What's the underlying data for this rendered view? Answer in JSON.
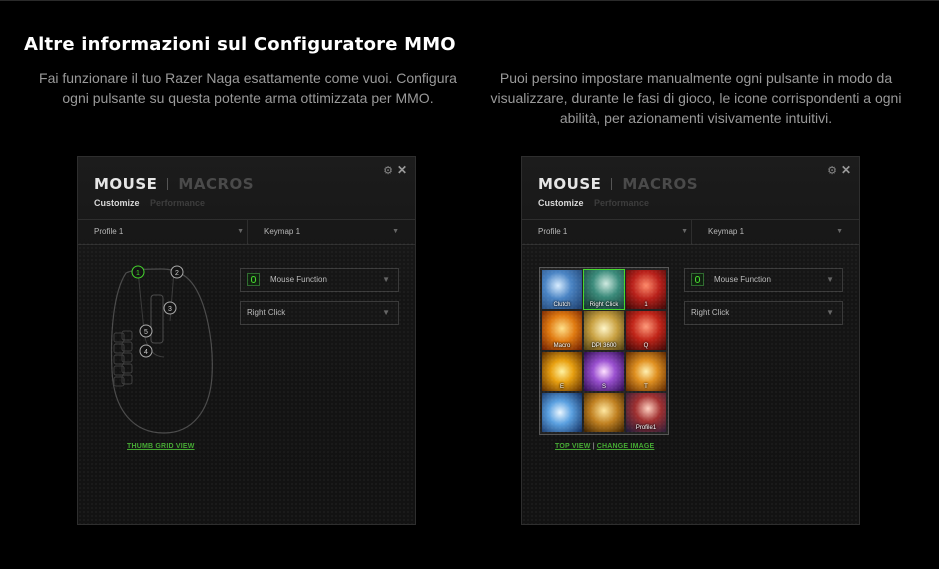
{
  "heading": "Altre informazioni sul Configuratore MMO",
  "intro_left": "Fai funzionare il tuo Razer Naga esattamente come vuoi. Configura ogni pulsante su questa potente arma ottimizzata per MMO.",
  "intro_right": "Puoi persino impostare manualmente ogni pulsante in modo da visualizzare, durante le fasi di gioco, le icone corrispondenti a ogni abilità, per azionamenti visivamente intuitivi.",
  "panels": [
    {
      "tab_mouse": "MOUSE",
      "tab_macros": "MACROS",
      "sub_customize": "Customize",
      "sub_performance": "Performance",
      "profile": "Profile 1",
      "keymap": "Keymap 1",
      "function": "Mouse Function",
      "button_action": "Right Click",
      "link": "THUMB GRID VIEW",
      "button_numbers": [
        "1",
        "2",
        "3",
        "5",
        "4"
      ]
    },
    {
      "tab_mouse": "MOUSE",
      "tab_macros": "MACROS",
      "sub_customize": "Customize",
      "sub_performance": "Performance",
      "profile": "Profile 1",
      "keymap": "Keymap 1",
      "function": "Mouse Function",
      "button_action": "Right Click",
      "link_top": "TOP VIEW",
      "link_sep": "|",
      "link_change": "CHANGE IMAGE",
      "grid_labels": [
        "Clutch",
        "Right Click",
        "1",
        "Macro",
        "DPI 3600",
        "Q",
        "E",
        "S",
        "T",
        "",
        "",
        "Profile1"
      ]
    }
  ],
  "colors": {
    "accent": "#44d62c",
    "link": "#44a832",
    "background": "#000000"
  },
  "icons": {
    "gear": "gear-icon",
    "close": "close-icon",
    "dropdown": "chevron-down-icon",
    "mouse": "mouse-icon"
  }
}
